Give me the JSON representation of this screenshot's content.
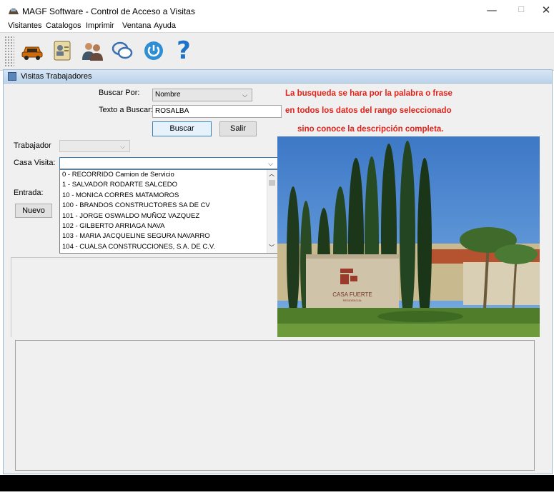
{
  "window": {
    "title": "MAGF Software - Control de Acceso a Visitas",
    "minimize": "—",
    "maximize": "☐",
    "close": "✕"
  },
  "menu": [
    "Visitantes",
    "Catalogos",
    "Imprimir",
    "Ventana",
    "Ayuda"
  ],
  "toolbar": {
    "icons": [
      "car-icon",
      "id-card-icon",
      "users-icon",
      "chat-bubbles-icon",
      "power-icon",
      "help-icon"
    ],
    "help_glyph": "?"
  },
  "frame": {
    "title": "Visitas Trabajadores"
  },
  "search": {
    "buscar_por_label": "Buscar Por:",
    "buscar_por_value": "Nombre",
    "texto_label": "Texto a Buscar:",
    "texto_value": "ROSALBA",
    "buscar_button": "Buscar",
    "salir_button": "Salir"
  },
  "hint": {
    "line1": "La busqueda se hara por la palabra o frase",
    "line2": "en todos los datos del rango seleccionado",
    "line3": "sino conoce la descripción completa."
  },
  "form": {
    "trabajador_label": "Trabajador",
    "trabajador_value": "",
    "casa_label": "Casa Visita:",
    "casa_value": "",
    "entrada_label": "Entrada:",
    "nuevo_button": "Nuevo",
    "casa_options": [
      "0 - RECORRIDO Camion de Servicio",
      "1 - SALVADOR RODARTE SALCEDO",
      "10 - MONICA CORRES MATAMOROS",
      "100 - BRANDOS CONSTRUCTORES SA DE CV",
      "101 - JORGE OSWALDO MUÑOZ VAZQUEZ",
      "102 - GILBERTO ARRIAGA NAVA",
      "103 - MARIA JACQUELINE SEGURA NAVARRO",
      "104 - CUALSA CONSTRUCCIONES, S.A. DE C.V."
    ]
  },
  "photo": {
    "sign_text": "CASA FUERTE",
    "sign_sub": "RESIDENCIAL"
  },
  "colors": {
    "hint_red": "#e2231a",
    "frame_title": "#c7dbef",
    "status_bar": "#000000"
  }
}
